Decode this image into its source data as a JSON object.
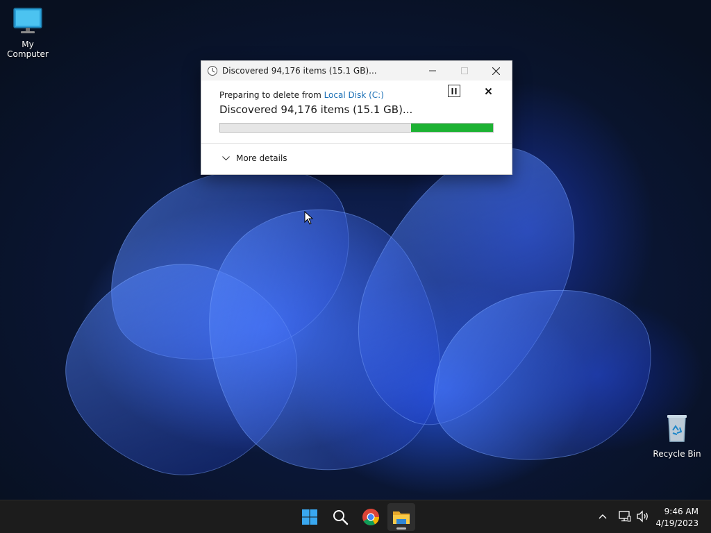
{
  "desktop": {
    "icons": [
      {
        "label": "My Computer",
        "icon": "monitor-icon"
      },
      {
        "label": "Recycle Bin",
        "icon": "recycle-bin-icon"
      }
    ]
  },
  "dialog": {
    "title": "Discovered 94,176 items (15.1 GB)...",
    "subline_prefix": "Preparing to delete from ",
    "location_link": "Local Disk (C:)",
    "status": "Discovered 94,176 items (15.1 GB)...",
    "progress": {
      "value": 0.3,
      "mode": "marquee"
    },
    "more_details_label": "More details",
    "accent_color": "#1db233",
    "link_color": "#1a6fb5"
  },
  "taskbar": {
    "apps": [
      "start-icon",
      "search-icon",
      "chrome-icon",
      "file-explorer-icon"
    ],
    "time": "9:46 AM",
    "date": "4/19/2023"
  }
}
